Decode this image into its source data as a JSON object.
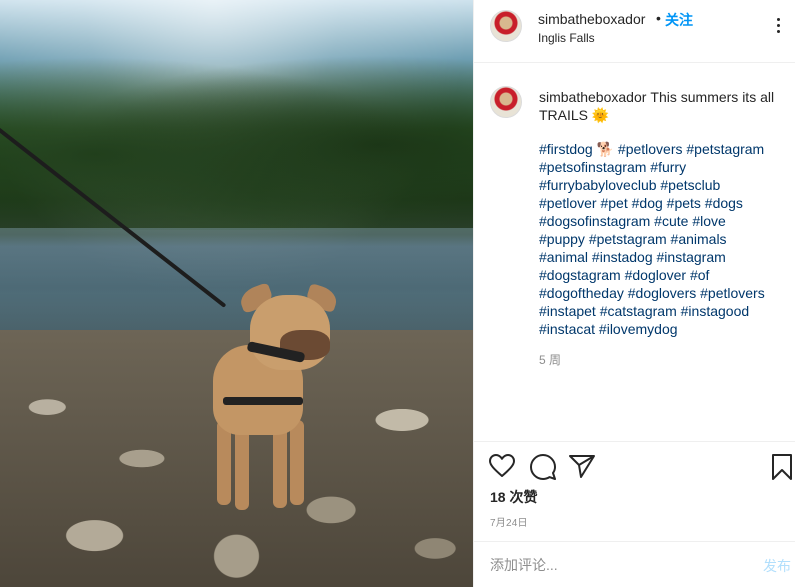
{
  "post": {
    "username": "simbatheboxador",
    "dot": "•",
    "follow_label": "关注",
    "location": "Inglis Falls",
    "caption_text": "This summers its all TRAILS 🌞",
    "hashtag_lines": [
      "#firstdog 🐕 #petlovers #petstagram",
      "#petsofinstagram #furry",
      "#furrybabyloveclub #petsclub",
      "#petlover #pet #dog #pets #dogs",
      "#dogsofinstagram #cute #love",
      "#puppy #petstagram #animals",
      "#animal #instadog #instagram",
      "#dogstagram #doglover #of",
      "#dogoftheday #doglovers #petlovers",
      "#instapet #catstagram #instagood",
      "#instacat #ilovemydog"
    ],
    "relative_time": "5 周",
    "likes": "18 次赞",
    "date": "7月24日"
  },
  "comment": {
    "placeholder": "添加评论...",
    "post_label": "发布"
  },
  "icons": {
    "more": "more-options-icon",
    "like": "heart-icon",
    "comment": "comment-icon",
    "share": "share-icon",
    "save": "bookmark-icon"
  },
  "colors": {
    "link_blue": "#0095f6",
    "hashtag": "#00376b",
    "muted": "#8e8e8e",
    "post_disabled": "#b2dffc"
  }
}
